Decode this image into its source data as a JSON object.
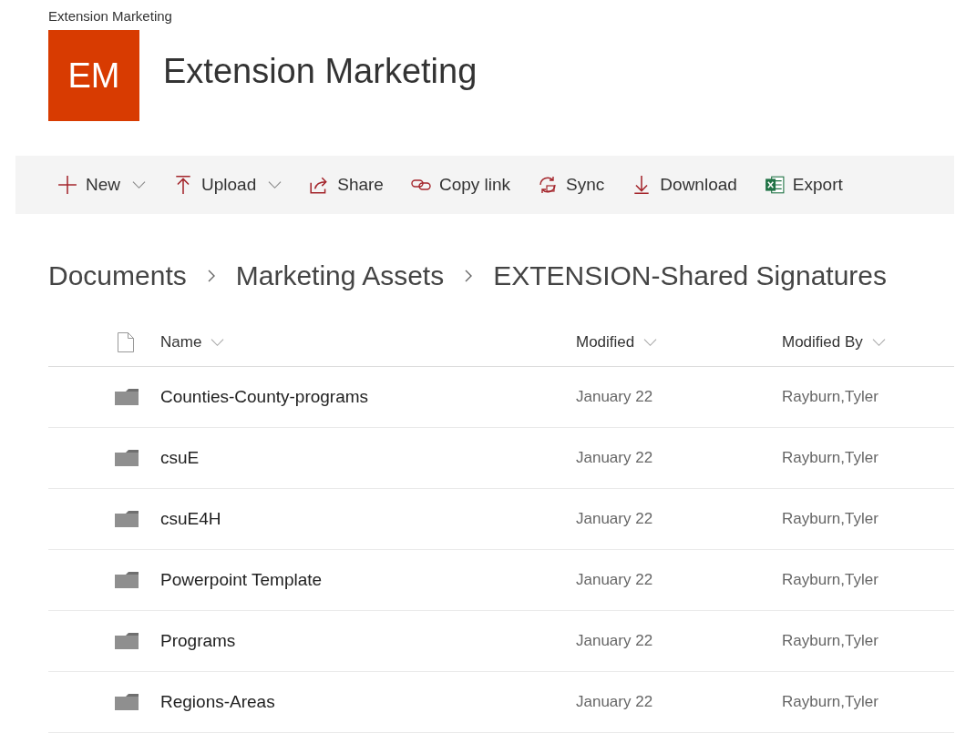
{
  "site": {
    "label": "Extension Marketing",
    "logo": "EM",
    "title": "Extension Marketing"
  },
  "toolbar": [
    {
      "kind": "new",
      "label": "New",
      "menu": true
    },
    {
      "kind": "upload",
      "label": "Upload",
      "menu": true
    },
    {
      "kind": "share",
      "label": "Share",
      "menu": false
    },
    {
      "kind": "link",
      "label": "Copy link",
      "menu": false
    },
    {
      "kind": "sync",
      "label": "Sync",
      "menu": false
    },
    {
      "kind": "download",
      "label": "Download",
      "menu": false
    },
    {
      "kind": "export",
      "label": "Export",
      "menu": false
    }
  ],
  "breadcrumb": [
    "Documents",
    "Marketing Assets",
    "EXTENSION-Shared Signatures"
  ],
  "table": {
    "columns": [
      "Name",
      "Modified",
      "Modified By"
    ],
    "rows": [
      {
        "name": "Counties-County-programs",
        "modified": "January 22",
        "modified_by": "Rayburn,Tyler"
      },
      {
        "name": "csuE",
        "modified": "January 22",
        "modified_by": "Rayburn,Tyler"
      },
      {
        "name": "csuE4H",
        "modified": "January 22",
        "modified_by": "Rayburn,Tyler"
      },
      {
        "name": "Powerpoint Template",
        "modified": "January 22",
        "modified_by": "Rayburn,Tyler"
      },
      {
        "name": "Programs",
        "modified": "January 22",
        "modified_by": "Rayburn,Tyler"
      },
      {
        "name": "Regions-Areas",
        "modified": "January 22",
        "modified_by": "Rayburn,Tyler"
      }
    ]
  }
}
